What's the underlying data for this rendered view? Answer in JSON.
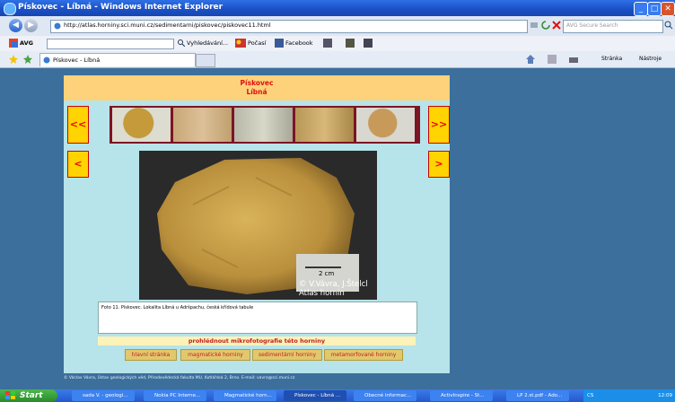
{
  "window": {
    "title": "Pískovec - Líbná - Windows Internet Explorer"
  },
  "nav": {
    "url": "http://atlas.horniny.sci.muni.cz/sedimentarni/piskovec/piskovec11.html",
    "search_placeholder": "AVG Secure Search"
  },
  "toolbar": {
    "avg": "AVG",
    "search": "Vyhledávání...",
    "weather": "Počasí",
    "facebook": "Facebook"
  },
  "tab": {
    "label": "Pískovec - Líbná"
  },
  "commandbar": {
    "page": "Stránka",
    "tools": "Nástroje"
  },
  "page": {
    "title_line1": "Pískovec",
    "title_line2": "Líbná",
    "prev_set": "<<",
    "next_set": ">>",
    "prev": "<",
    "next": ">",
    "photo_credit1": "© V.Vávra, J.Štelcl",
    "photo_credit2": "Atlas hornin",
    "scale_label": "2 cm",
    "caption": "Foto 11. Pískovec. Lokalita Líbná u Adršpachu, česká křídová tabule",
    "microphoto_link": "prohlédnout mikrofotografie této horniny",
    "categories": [
      "hlavní stránka",
      "magmatické horniny",
      "sedimentární horniny",
      "metamorfované horniny"
    ],
    "footer": "© Václav Vávra, Ústav geologických věd, Přírodovědecká fakulta MU, Kotlářská 2, Brno. E-mail: vavra@sci.muni.cz"
  },
  "taskbar": {
    "start": "Start",
    "items": [
      "sada V. - geologi...",
      "Nokia PC Interne...",
      "Magmatické horn...",
      "Pískovec - Líbná ...",
      "Obecné informac...",
      "ActivInspire - St...",
      "LP 2.st.pdf - Ado..."
    ],
    "tray_lang": "CS",
    "clock": "12:09"
  }
}
